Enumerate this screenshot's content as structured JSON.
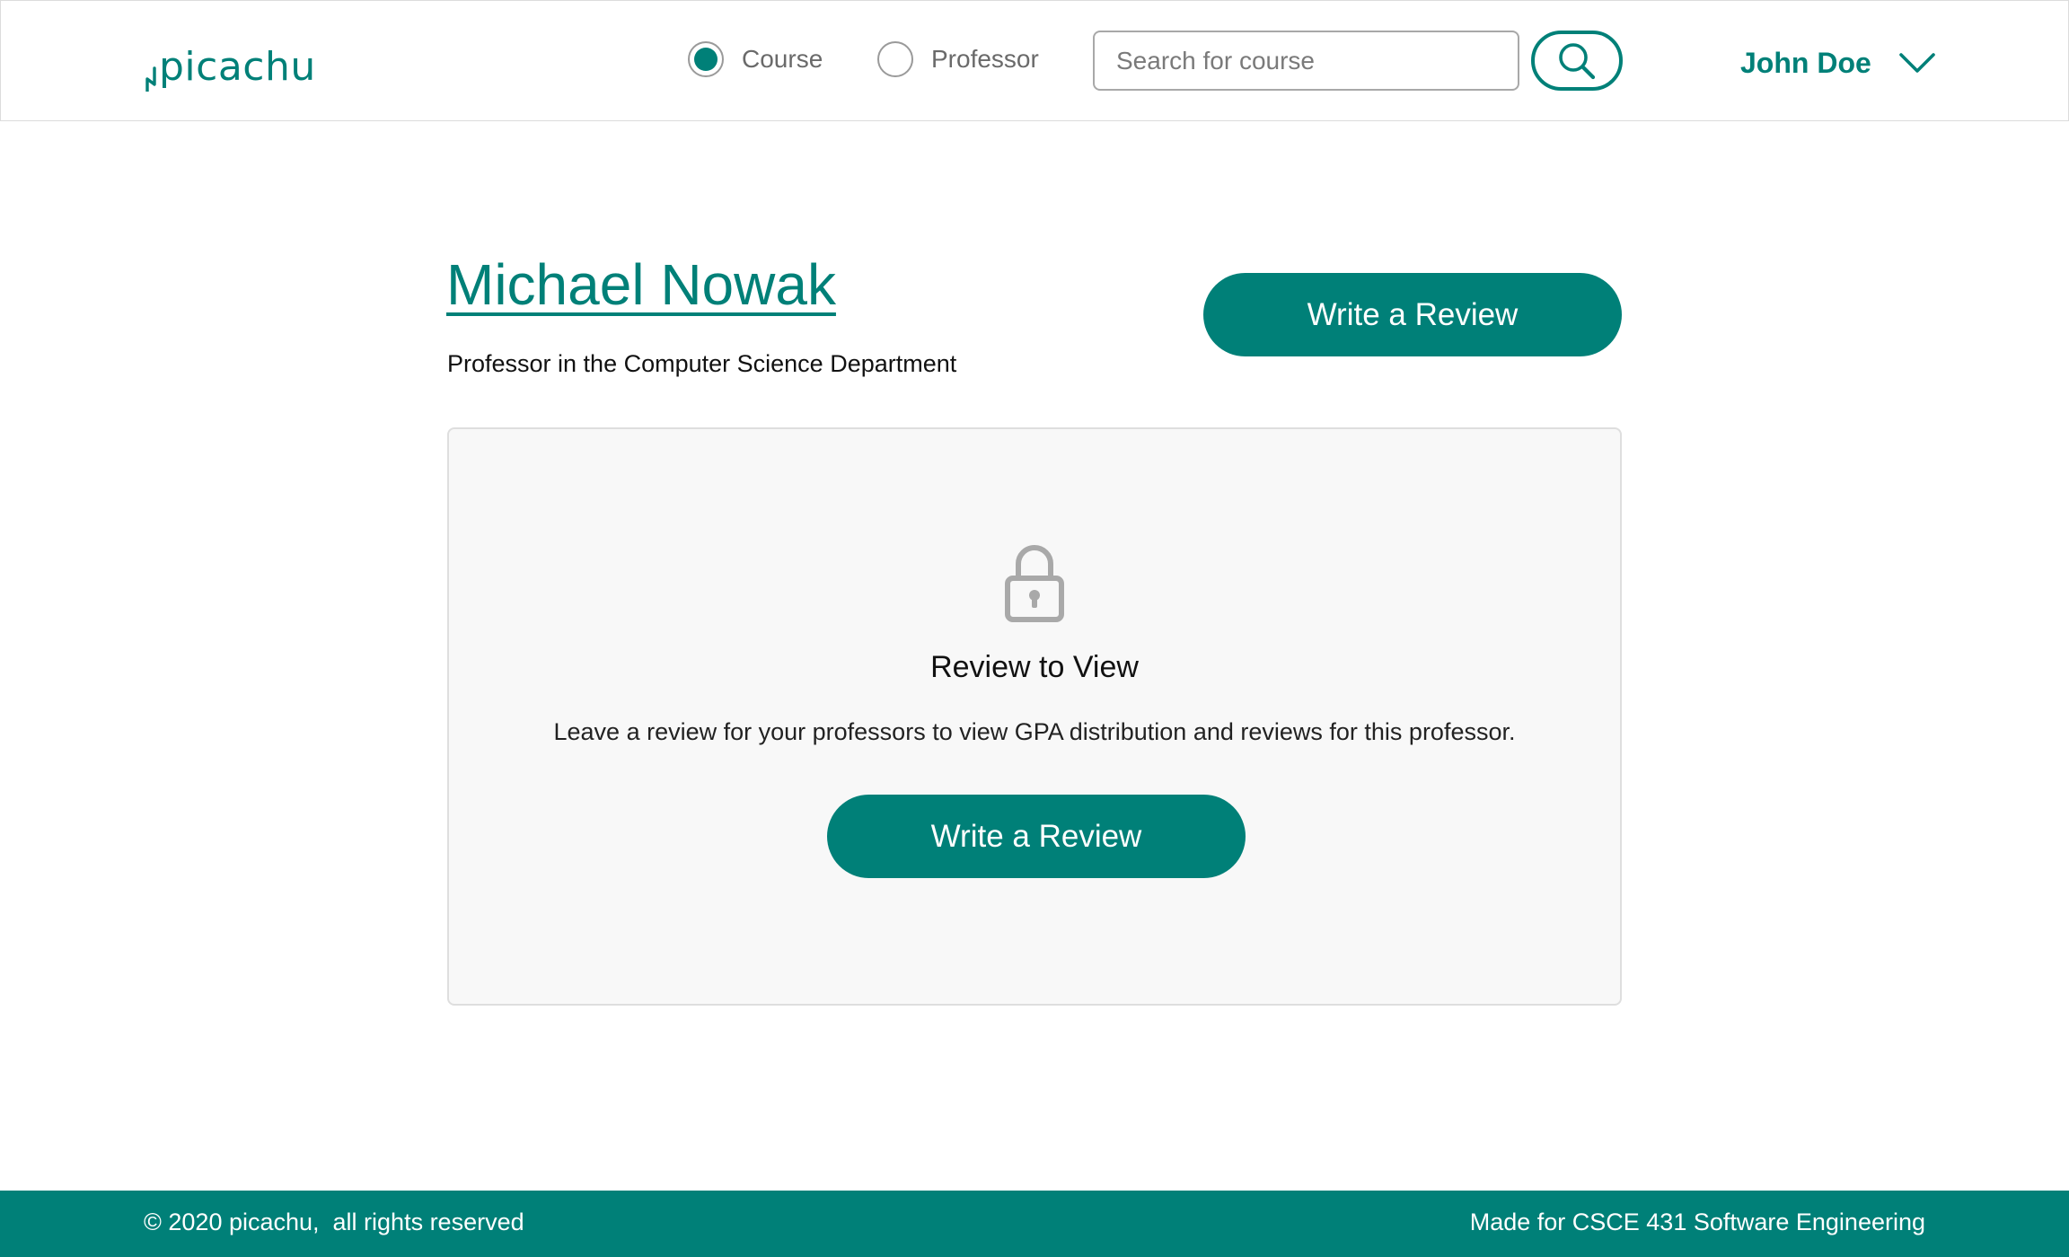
{
  "header": {
    "logo_text": "picachu",
    "search_mode": {
      "options": [
        {
          "label": "Course",
          "selected": true
        },
        {
          "label": "Professor",
          "selected": false
        }
      ]
    },
    "search": {
      "placeholder": "Search for course",
      "value": ""
    },
    "search_button_icon": "search-icon",
    "user": {
      "name": "John Doe",
      "menu_icon": "chevron-down-icon"
    }
  },
  "professor": {
    "name": "Michael Nowak",
    "subtitle": "Professor in the Computer Science Department",
    "write_review_label": "Write a Review"
  },
  "locked_section": {
    "icon": "lock-icon",
    "title": "Review to View",
    "message": "Leave a review for your professors to view GPA distribution and reviews for this professor.",
    "button_label": "Write a Review"
  },
  "footer": {
    "left_text": "© 2020 picachu,  all rights reserved",
    "right_text": "Made for CSCE 431 Software Engineering"
  },
  "colors": {
    "accent": "#008078",
    "card_background": "#f8f8f8",
    "icon_gray": "#a9a9a9"
  }
}
